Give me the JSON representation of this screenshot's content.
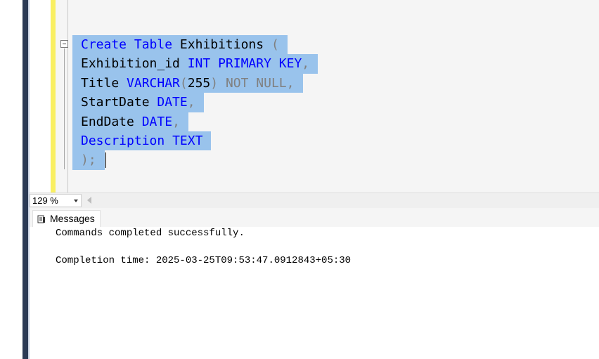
{
  "editor": {
    "lines": [
      [
        {
          "t": "Create",
          "c": "kw"
        },
        {
          "t": " ",
          "c": "plain"
        },
        {
          "t": "Table",
          "c": "kw"
        },
        {
          "t": " Exhibitions ",
          "c": "plain"
        },
        {
          "t": "(",
          "c": "gray"
        }
      ],
      [
        {
          "t": "Exhibition_id ",
          "c": "plain"
        },
        {
          "t": "INT",
          "c": "kw"
        },
        {
          "t": " ",
          "c": "plain"
        },
        {
          "t": "PRIMARY",
          "c": "kw"
        },
        {
          "t": " ",
          "c": "plain"
        },
        {
          "t": "KEY",
          "c": "kw"
        },
        {
          "t": ",",
          "c": "gray"
        }
      ],
      [
        {
          "t": "Title ",
          "c": "plain"
        },
        {
          "t": "VARCHAR",
          "c": "kw"
        },
        {
          "t": "(",
          "c": "gray"
        },
        {
          "t": "255",
          "c": "plain"
        },
        {
          "t": ")",
          "c": "gray"
        },
        {
          "t": " ",
          "c": "plain"
        },
        {
          "t": "NOT",
          "c": "gray"
        },
        {
          "t": " ",
          "c": "plain"
        },
        {
          "t": "NULL",
          "c": "gray"
        },
        {
          "t": ",",
          "c": "gray"
        }
      ],
      [
        {
          "t": "StartDate ",
          "c": "plain"
        },
        {
          "t": "DATE",
          "c": "kw"
        },
        {
          "t": ",",
          "c": "gray"
        }
      ],
      [
        {
          "t": "EndDate ",
          "c": "plain"
        },
        {
          "t": "DATE",
          "c": "kw"
        },
        {
          "t": ",",
          "c": "gray"
        }
      ],
      [
        {
          "t": "Description",
          "c": "kw"
        },
        {
          "t": " ",
          "c": "plain"
        },
        {
          "t": "TEXT",
          "c": "kw"
        }
      ],
      [
        {
          "t": ");",
          "c": "gray"
        }
      ]
    ]
  },
  "zoom": {
    "value": "129 %"
  },
  "tabs": {
    "messages_label": "Messages"
  },
  "messages": {
    "line1": "Commands completed successfully.",
    "line2": "Completion time: 2025-03-25T09:53:47.0912843+05:30"
  },
  "colors": {
    "keyword": "#0000ff",
    "selection": "#99c3ec",
    "gray": "#808080"
  }
}
